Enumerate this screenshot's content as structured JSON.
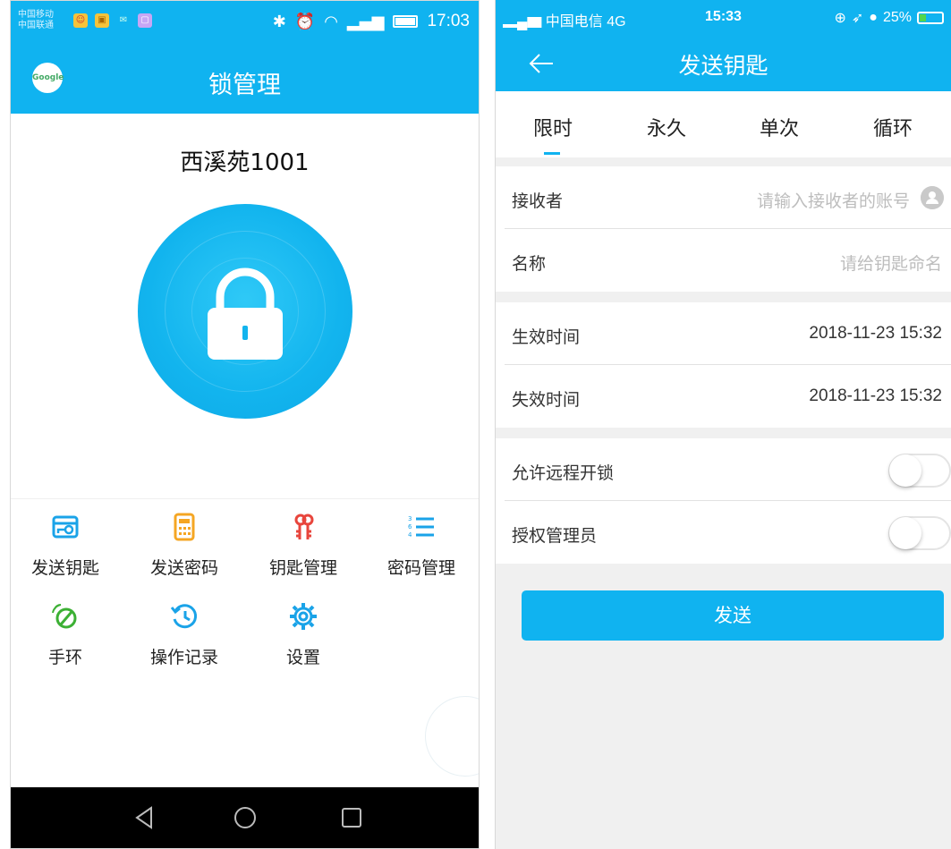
{
  "left": {
    "status_bar": {
      "carrier1": "中国移动",
      "carrier2": "中国联通",
      "time": "17:03"
    },
    "header": {
      "title": "锁管理",
      "logo_text": "Google"
    },
    "lock_name": "西溪苑1001",
    "tiles": [
      {
        "label": "发送钥匙",
        "icon": "send-key-icon",
        "color": "#1aa3e8"
      },
      {
        "label": "发送密码",
        "icon": "calculator-icon",
        "color": "#f5a623"
      },
      {
        "label": "钥匙管理",
        "icon": "keys-icon",
        "color": "#e8453c"
      },
      {
        "label": "密码管理",
        "icon": "numbered-list-icon",
        "color": "#1aa3e8"
      },
      {
        "label": "手环",
        "icon": "bracelet-icon",
        "color": "#3cb034"
      },
      {
        "label": "操作记录",
        "icon": "history-icon",
        "color": "#1aa3e8"
      },
      {
        "label": "设置",
        "icon": "gear-icon",
        "color": "#1aa3e8"
      }
    ]
  },
  "right": {
    "status_bar": {
      "carrier": "中国电信 4G",
      "time": "15:33",
      "battery": "25%"
    },
    "header": {
      "title": "发送钥匙"
    },
    "tabs": [
      {
        "label": "限时",
        "active": true
      },
      {
        "label": "永久",
        "active": false
      },
      {
        "label": "单次",
        "active": false
      },
      {
        "label": "循环",
        "active": false
      }
    ],
    "form": {
      "receiver_label": "接收者",
      "receiver_placeholder": "请输入接收者的账号",
      "name_label": "名称",
      "name_placeholder": "请给钥匙命名",
      "start_label": "生效时间",
      "start_value": "2018-11-23 15:32",
      "end_label": "失效时间",
      "end_value": "2018-11-23 15:32",
      "remote_label": "允许远程开锁",
      "remote_on": false,
      "admin_label": "授权管理员",
      "admin_on": false
    },
    "send_label": "发送"
  },
  "colors": {
    "accent": "#10b3f0",
    "background": "#f0f0f0"
  }
}
